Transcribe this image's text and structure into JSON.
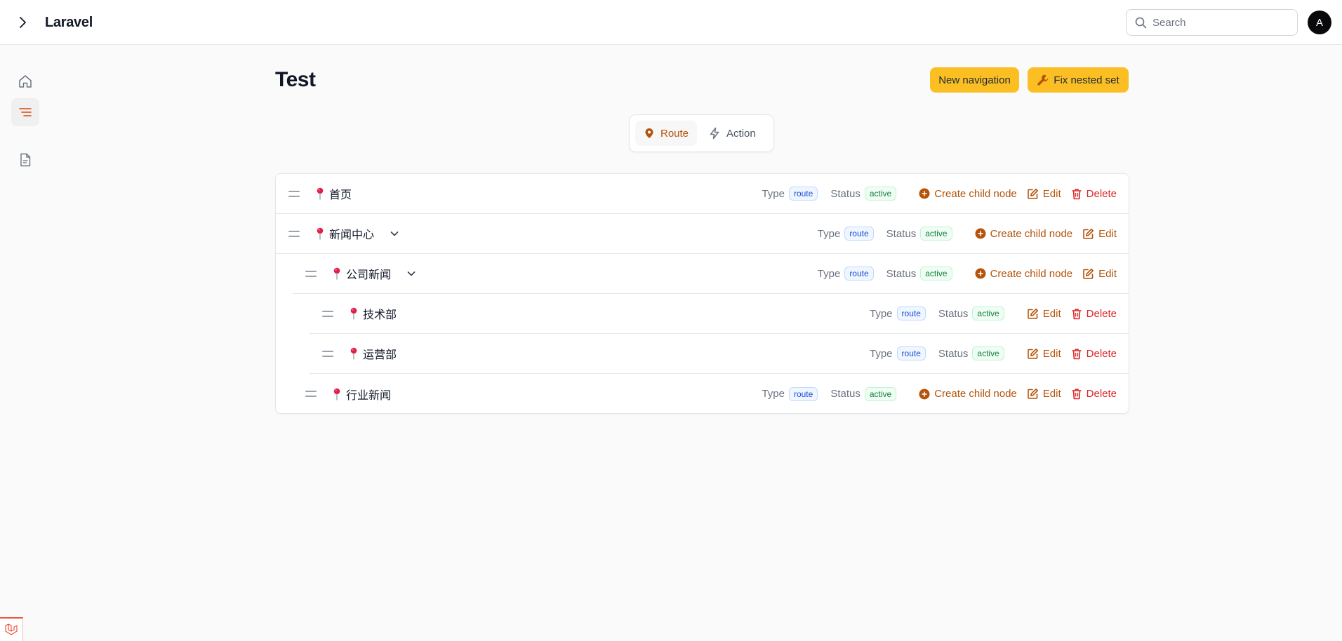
{
  "app": {
    "brand": "Laravel",
    "avatar_initial": "A"
  },
  "search": {
    "placeholder": "Search",
    "value": ""
  },
  "sidebar": {
    "items": [
      {
        "icon": "home-icon",
        "active": false
      },
      {
        "icon": "menu-lines-icon",
        "active": true
      },
      {
        "icon": "document-icon",
        "active": false
      }
    ]
  },
  "page": {
    "title": "Test",
    "new_navigation_label": "New navigation",
    "fix_nested_set_label": "Fix nested set"
  },
  "tabs": [
    {
      "label": "Route",
      "active": true
    },
    {
      "label": "Action",
      "active": false
    }
  ],
  "tree": {
    "type_label": "Type",
    "status_label": "Status",
    "create_child_label": "Create child node",
    "edit_label": "Edit",
    "delete_label": "Delete",
    "rows": [
      {
        "label": "首页",
        "type": "route",
        "status": "active",
        "depth": 0,
        "expandable": false,
        "create_child": true,
        "delete": true
      },
      {
        "label": "新闻中心",
        "type": "route",
        "status": "active",
        "depth": 0,
        "expandable": true,
        "create_child": true,
        "delete": false
      },
      {
        "label": "公司新闻",
        "type": "route",
        "status": "active",
        "depth": 1,
        "expandable": true,
        "create_child": true,
        "delete": false
      },
      {
        "label": "技术部",
        "type": "route",
        "status": "active",
        "depth": 2,
        "expandable": false,
        "create_child": false,
        "delete": true
      },
      {
        "label": "运营部",
        "type": "route",
        "status": "active",
        "depth": 2,
        "expandable": false,
        "create_child": false,
        "delete": true
      },
      {
        "label": "行业新闻",
        "type": "route",
        "status": "active",
        "depth": 1,
        "expandable": false,
        "create_child": true,
        "delete": true
      }
    ]
  },
  "colors": {
    "accent": "#b45309",
    "danger": "#dc2626",
    "button": "#fbbf24"
  }
}
